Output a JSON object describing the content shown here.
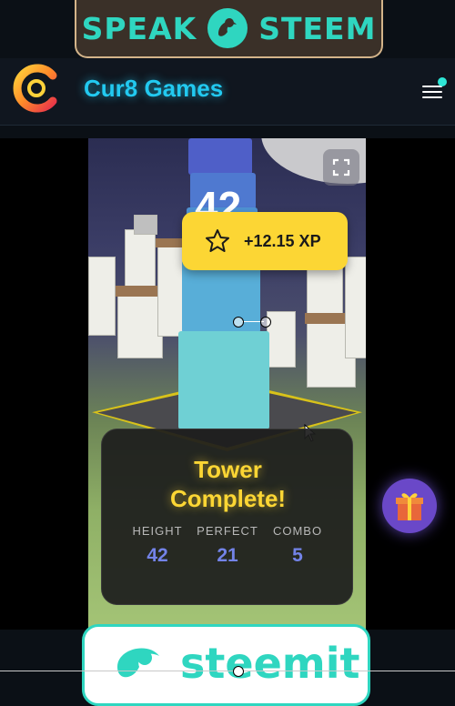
{
  "top_banner": {
    "left_word": "SPEAK",
    "right_word": "STEEM"
  },
  "header": {
    "title": "Cur8 Games",
    "menu_icon": "hamburger-icon"
  },
  "game": {
    "score": "42",
    "xp_toast": "+12.15 XP",
    "result": {
      "title_line1": "Tower",
      "title_line2": "Complete!",
      "stats": [
        {
          "label": "HEIGHT",
          "value": "42"
        },
        {
          "label": "PERFECT",
          "value": "21"
        },
        {
          "label": "COMBO",
          "value": "5"
        }
      ]
    }
  },
  "bottom_banner": {
    "word": "steemit"
  },
  "colors": {
    "accent_cyan": "#22c9f0",
    "brand_teal": "#2fd6c0",
    "xp_yellow": "#fcd634",
    "stat_blue": "#7383e8",
    "gift_purple": "#6a48c8"
  }
}
